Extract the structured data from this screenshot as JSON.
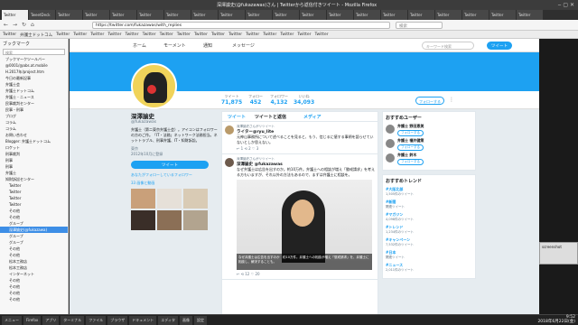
{
  "window": {
    "title": "深澤諭史(@fukazawas)さん | Twitterから返信付きツイート - Mozilla Firefox",
    "controls": "‒ ▢ ✕"
  },
  "tabs": [
    "Twitter",
    "TweetDeck",
    "Twitter",
    "Twitter",
    "Twitter",
    "Twitter",
    "Twitter",
    "Twitter",
    "Twitter",
    "Twitter",
    "Twitter",
    "Twitter",
    "Twitter",
    "Twitter",
    "Twitter",
    "Twitter",
    "Twitter",
    "Twitter",
    "Twitter",
    "Twitter"
  ],
  "nav": {
    "back": "←",
    "forward": "→",
    "reload": "↻",
    "home": "⌂",
    "url": "https://twitter.com/fukazawas/with_replies",
    "search_placeholder": "検索"
  },
  "bookmarks": [
    "Twitter",
    "弁護士ドットコム",
    "Twitter",
    "Twitter",
    "Twitter",
    "Twitter",
    "Twitter",
    "Twitter",
    "Twitter",
    "Twitter",
    "Twitter",
    "Twitter",
    "Twitter",
    "Twitter",
    "Twitter",
    "Twitter",
    "Twitter",
    "Twitter"
  ],
  "sidebar": {
    "title": "ブックマーク",
    "search_placeholder": "検索",
    "items": [
      "ブックマークツールバー",
      "@0001/@abs.at.mobile",
      "H.2017年/project.htm",
      "今日の最新記事",
      "弁護士会",
      "弁護士ドットコム",
      "弁護士 - ニュース",
      "民事裁判センター",
      "民事・刑事",
      "ブログ",
      "コラム",
      "コラム",
      "お問い合わせ",
      "Blogger: 弁護士ドットコム",
      "ロケット",
      "刑事裁判",
      "刑事",
      "刑事",
      "弁護士",
      "知財訴訟センター",
      "Twitter",
      "Twitter",
      "Twitter",
      "Twitter",
      "その他",
      "その他",
      "グループ",
      "深澤諭史(@fukazawa)",
      "グループ",
      "グループ",
      "その他",
      "その他",
      "松本工務店",
      "松本工務店",
      "インターネット",
      "その他",
      "その他",
      "その他",
      "その他"
    ],
    "selected_index": 27
  },
  "twitter_nav": {
    "home": "ホーム",
    "moments": "モーメント",
    "notifications": "通知",
    "messages": "メッセージ",
    "search_placeholder": "キーワード検索",
    "tweet": "ツイート"
  },
  "profile": {
    "stats": [
      {
        "label": "ツイート",
        "value": "71,875"
      },
      {
        "label": "フォロー",
        "value": "452"
      },
      {
        "label": "フォロワー",
        "value": "4,132"
      },
      {
        "label": "いいね",
        "value": "34,093"
      }
    ],
    "follow_button": "フォローする",
    "more": "⋮",
    "name": "深澤諭史",
    "handle": "@fukazawas",
    "bio": "弁護士（第二東京弁護士会）。アイコンはフォロワーの方のご作。「IT・法務」ネットワーク法務担当。ネットトラブル、刑事弁護、IT・知財訴訟。",
    "location": "東京",
    "joined": "2012年10月に登録",
    "profile_tweet": "ツイート",
    "followers_you_know": "あなたがフォローしているフォロワー",
    "photos_label": "33 画像と動画"
  },
  "timeline": {
    "tabs": {
      "tweets": "ツイート",
      "replies": "ツイートと返信",
      "media": "メディア"
    },
    "tweets": [
      {
        "context": "深澤諭史さんがリツイート",
        "author": "ライター@ryu_lite",
        "body": "元神山事務所について述べることを見ると、もう、信じるに値する事柄を語らせていないとしか思えない。",
        "actions": "↩ 1  ⟲ 2  ♡ 3"
      },
      {
        "context": "深澤諭史さんがリツイート",
        "author": "深澤諭史 @fukazawas",
        "body": "なぜ弁護士は広告を出すのか。約10万件。弁護士への相談が増え「懲戒請求」を考える方もいますが、それ以外の方法もあるので、まずは弁護士に相談を。",
        "actions": "↩  ⟲ 12  ♡ 20",
        "caption": "なぜ弁護士は広告を出すのか　約10万件。弁護士への相談が増え「懲戒請求」を、弁護士に相談し、解決することも。"
      }
    ]
  },
  "suggestions": {
    "title": "おすすめユーザー",
    "users": [
      {
        "name": "弁護士 野田恵美",
        "button": "フォローする"
      },
      {
        "name": "弁護士 福井健策",
        "button": "フォローする"
      },
      {
        "name": "弁護士 鈴木",
        "button": "フォローする"
      }
    ]
  },
  "trends": {
    "title": "おすすめトレンド",
    "items": [
      {
        "name": "#大阪北部",
        "count": "1,505件のツイート"
      },
      {
        "name": "#新聞",
        "count": "関連ツイート"
      },
      {
        "name": "#マガジン",
        "count": "4,098件のツイート"
      },
      {
        "name": "#トレンド",
        "count": "1,234件のツイート"
      },
      {
        "name": "#キャンペーン",
        "count": "7,532件のツイート"
      },
      {
        "name": "#日本",
        "count": "関連ツイート"
      },
      {
        "name": "#ニュース",
        "count": "2,011件のツイート"
      }
    ]
  },
  "outer_dialog": "screenshot",
  "taskbar": {
    "items": [
      "メニュー",
      "Firefox",
      "アプリ",
      "ターミナル",
      "ファイル",
      "ブラウザ",
      "ドキュメント",
      "エディタ",
      "画像",
      "設定"
    ],
    "clock_time": "9:52",
    "clock_date": "2018年6月22日(金)"
  }
}
